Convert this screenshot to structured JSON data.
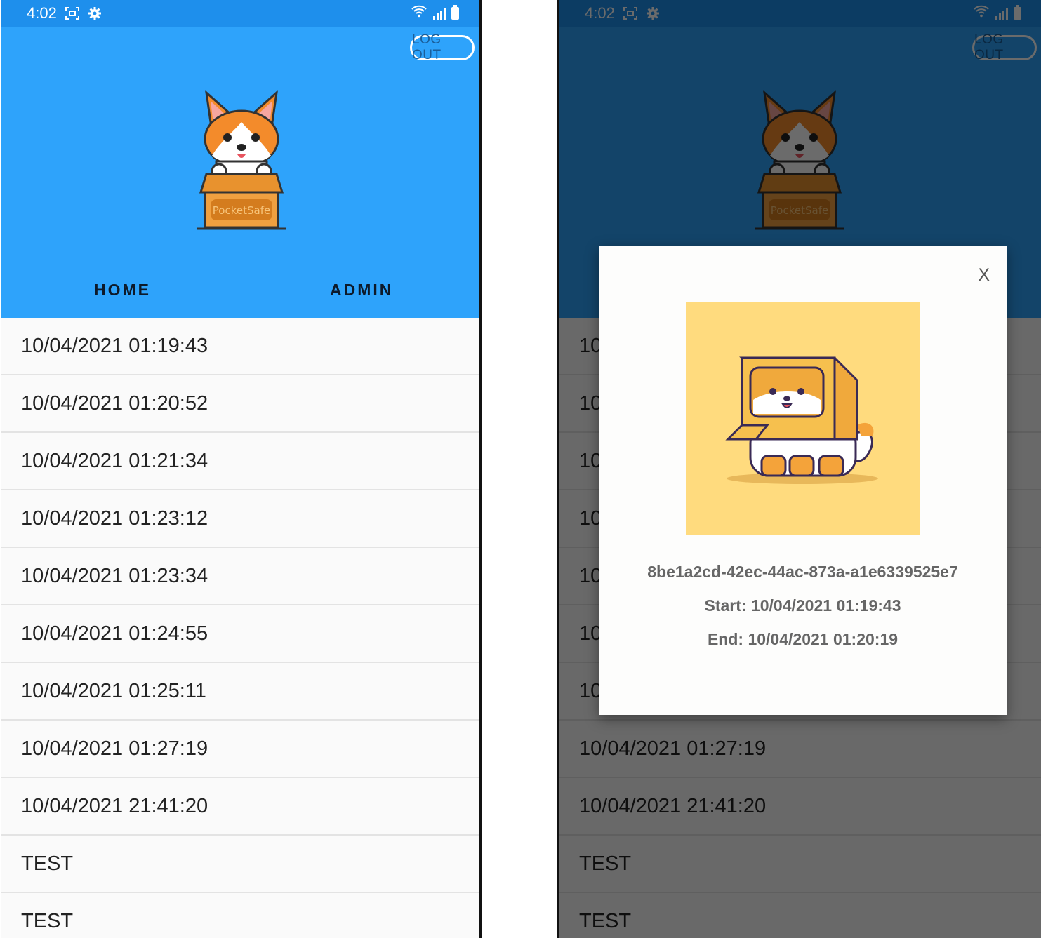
{
  "status_bar": {
    "time": "4:02"
  },
  "header": {
    "logout_label": "LOG OUT",
    "logo_text": "PocketSafe"
  },
  "tabs": [
    {
      "label": "HOME"
    },
    {
      "label": "ADMIN"
    }
  ],
  "list": {
    "items": [
      {
        "label": "10/04/2021 01:19:43"
      },
      {
        "label": "10/04/2021 01:20:52"
      },
      {
        "label": "10/04/2021 01:21:34"
      },
      {
        "label": "10/04/2021 01:23:12"
      },
      {
        "label": "10/04/2021 01:23:34"
      },
      {
        "label": "10/04/2021 01:24:55"
      },
      {
        "label": "10/04/2021 01:25:11"
      },
      {
        "label": "10/04/2021 01:27:19"
      },
      {
        "label": "10/04/2021 21:41:20"
      },
      {
        "label": "TEST"
      },
      {
        "label": "TEST"
      }
    ]
  },
  "modal": {
    "close_label": "X",
    "id": "8be1a2cd-42ec-44ac-873a-a1e6339525e7",
    "start": "Start: 10/04/2021 01:19:43",
    "end": "End: 10/04/2021 01:20:19"
  },
  "colors": {
    "status_bar": "#1e8fec",
    "header_blue": "#2ea3fb",
    "list_bg": "#fafafa",
    "modal_image_bg": "#ffdb7e"
  },
  "icons": [
    "screenshot-icon",
    "gear-icon",
    "wifi-icon",
    "signal-icon",
    "battery-icon",
    "close-icon"
  ]
}
